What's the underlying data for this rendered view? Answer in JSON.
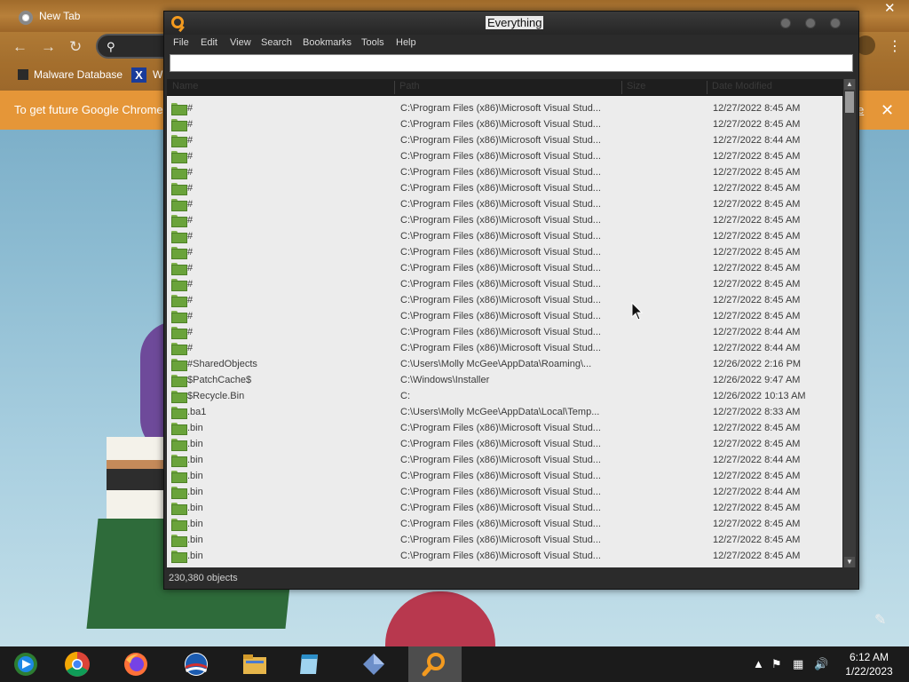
{
  "chrome": {
    "tab_title": "New Tab",
    "bookmarks": [
      "Malware Database",
      "W"
    ],
    "infobar_text": "To get future Google Chrome",
    "infobar_link": "e"
  },
  "everything": {
    "title": "Everything",
    "menu": [
      "File",
      "Edit",
      "View",
      "Search",
      "Bookmarks",
      "Tools",
      "Help"
    ],
    "search_value": "",
    "columns": [
      "Name",
      "Path",
      "Size",
      "Date Modified"
    ],
    "rows": [
      {
        "name": "#",
        "path": "C:\\Program Files (x86)\\Microsoft Visual Stud...",
        "date": "12/27/2022 8:45 AM"
      },
      {
        "name": "#",
        "path": "C:\\Program Files (x86)\\Microsoft Visual Stud...",
        "date": "12/27/2022 8:45 AM"
      },
      {
        "name": "#",
        "path": "C:\\Program Files (x86)\\Microsoft Visual Stud...",
        "date": "12/27/2022 8:44 AM"
      },
      {
        "name": "#",
        "path": "C:\\Program Files (x86)\\Microsoft Visual Stud...",
        "date": "12/27/2022 8:45 AM"
      },
      {
        "name": "#",
        "path": "C:\\Program Files (x86)\\Microsoft Visual Stud...",
        "date": "12/27/2022 8:45 AM"
      },
      {
        "name": "#",
        "path": "C:\\Program Files (x86)\\Microsoft Visual Stud...",
        "date": "12/27/2022 8:45 AM"
      },
      {
        "name": "#",
        "path": "C:\\Program Files (x86)\\Microsoft Visual Stud...",
        "date": "12/27/2022 8:45 AM"
      },
      {
        "name": "#",
        "path": "C:\\Program Files (x86)\\Microsoft Visual Stud...",
        "date": "12/27/2022 8:45 AM"
      },
      {
        "name": "#",
        "path": "C:\\Program Files (x86)\\Microsoft Visual Stud...",
        "date": "12/27/2022 8:45 AM"
      },
      {
        "name": "#",
        "path": "C:\\Program Files (x86)\\Microsoft Visual Stud...",
        "date": "12/27/2022 8:45 AM"
      },
      {
        "name": "#",
        "path": "C:\\Program Files (x86)\\Microsoft Visual Stud...",
        "date": "12/27/2022 8:45 AM"
      },
      {
        "name": "#",
        "path": "C:\\Program Files (x86)\\Microsoft Visual Stud...",
        "date": "12/27/2022 8:45 AM"
      },
      {
        "name": "#",
        "path": "C:\\Program Files (x86)\\Microsoft Visual Stud...",
        "date": "12/27/2022 8:45 AM"
      },
      {
        "name": "#",
        "path": "C:\\Program Files (x86)\\Microsoft Visual Stud...",
        "date": "12/27/2022 8:45 AM"
      },
      {
        "name": "#",
        "path": "C:\\Program Files (x86)\\Microsoft Visual Stud...",
        "date": "12/27/2022 8:44 AM"
      },
      {
        "name": "#",
        "path": "C:\\Program Files (x86)\\Microsoft Visual Stud...",
        "date": "12/27/2022 8:44 AM"
      },
      {
        "name": "#SharedObjects",
        "path": "C:\\Users\\Molly McGee\\AppData\\Roaming\\...",
        "date": "12/26/2022 2:16 PM"
      },
      {
        "name": "$PatchCache$",
        "path": "C:\\Windows\\Installer",
        "date": "12/26/2022 9:47 AM"
      },
      {
        "name": "$Recycle.Bin",
        "path": "C:",
        "date": "12/26/2022 10:13 AM"
      },
      {
        "name": ".ba1",
        "path": "C:\\Users\\Molly McGee\\AppData\\Local\\Temp...",
        "date": "12/27/2022 8:33 AM"
      },
      {
        "name": ".bin",
        "path": "C:\\Program Files (x86)\\Microsoft Visual Stud...",
        "date": "12/27/2022 8:45 AM"
      },
      {
        "name": ".bin",
        "path": "C:\\Program Files (x86)\\Microsoft Visual Stud...",
        "date": "12/27/2022 8:45 AM"
      },
      {
        "name": ".bin",
        "path": "C:\\Program Files (x86)\\Microsoft Visual Stud...",
        "date": "12/27/2022 8:44 AM"
      },
      {
        "name": ".bin",
        "path": "C:\\Program Files (x86)\\Microsoft Visual Stud...",
        "date": "12/27/2022 8:45 AM"
      },
      {
        "name": ".bin",
        "path": "C:\\Program Files (x86)\\Microsoft Visual Stud...",
        "date": "12/27/2022 8:44 AM"
      },
      {
        "name": ".bin",
        "path": "C:\\Program Files (x86)\\Microsoft Visual Stud...",
        "date": "12/27/2022 8:45 AM"
      },
      {
        "name": ".bin",
        "path": "C:\\Program Files (x86)\\Microsoft Visual Stud...",
        "date": "12/27/2022 8:45 AM"
      },
      {
        "name": ".bin",
        "path": "C:\\Program Files (x86)\\Microsoft Visual Stud...",
        "date": "12/27/2022 8:45 AM"
      },
      {
        "name": ".bin",
        "path": "C:\\Program Files (x86)\\Microsoft Visual Stud...",
        "date": "12/27/2022 8:45 AM"
      }
    ],
    "status": "230,380 objects",
    "accent_color": "#f39a1f"
  },
  "taskbar": {
    "items": [
      "windows-media-center-icon",
      "chrome-icon",
      "firefox-icon",
      "obama-logo-icon",
      "file-explorer-icon",
      "notepad-icon",
      "diamond-app-icon",
      "everything-icon"
    ],
    "clock_time": "6:12 AM",
    "clock_date": "1/22/2023"
  }
}
